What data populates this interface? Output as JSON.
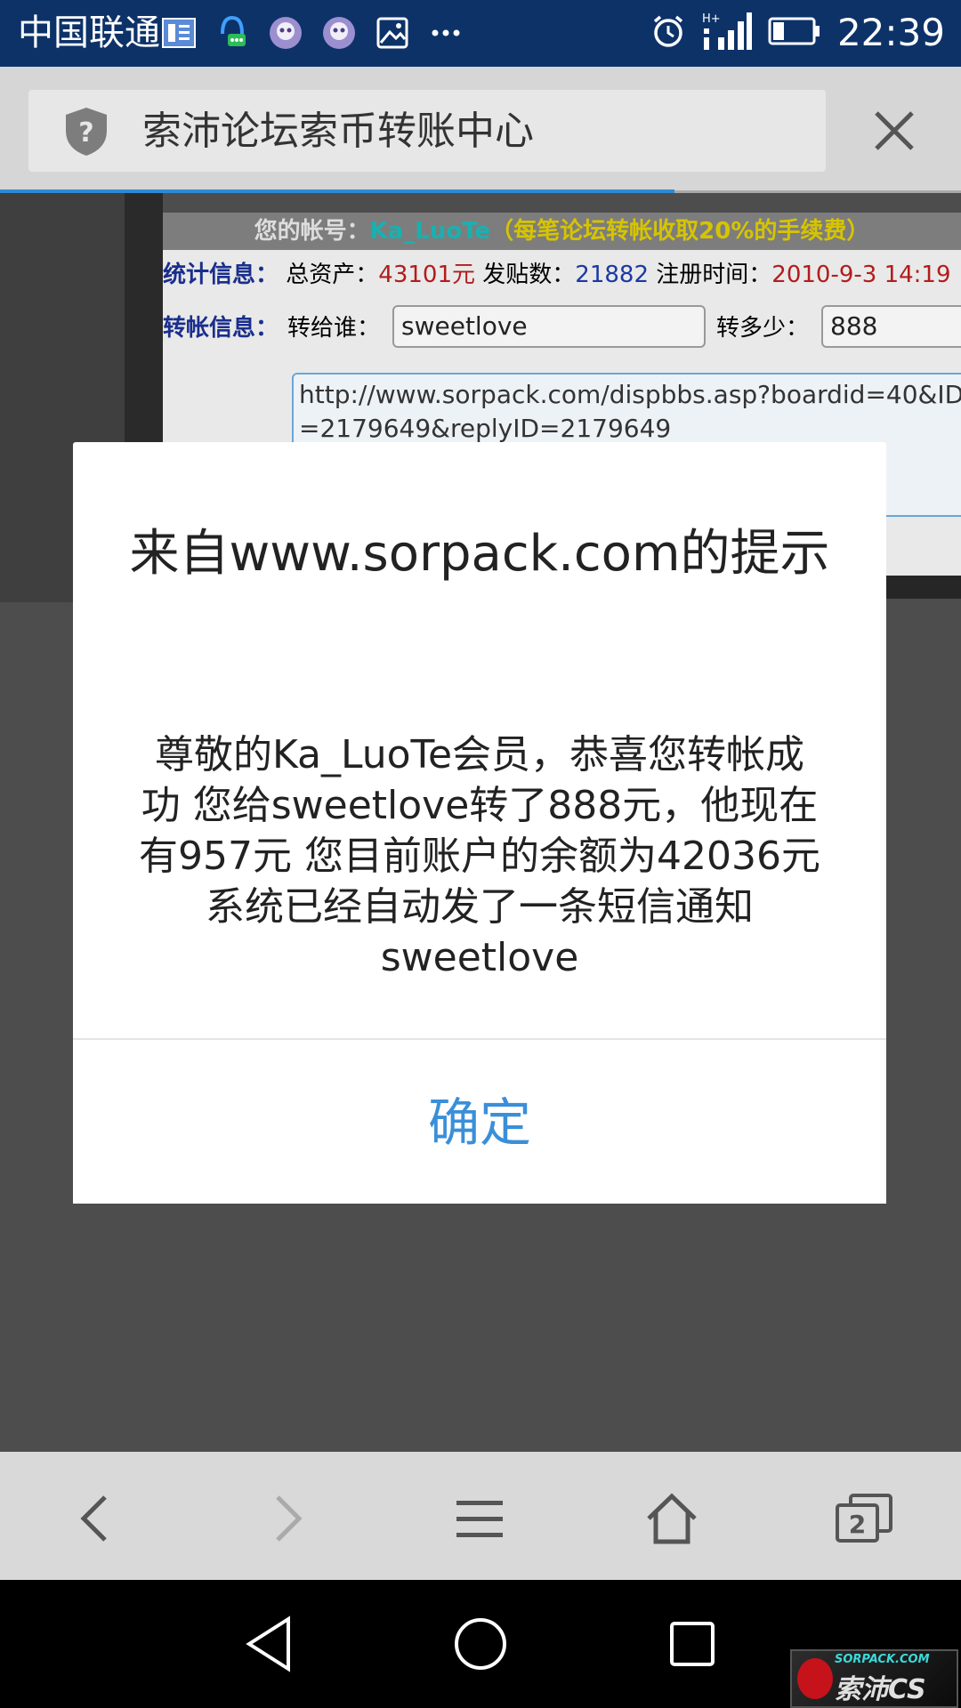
{
  "statusbar": {
    "carrier": "中国联通",
    "time": "22:39",
    "network": "H+"
  },
  "browser": {
    "page_title": "索沛论坛索币转账中心",
    "tabs_count": "2"
  },
  "form": {
    "account_label": "您的帐号：",
    "account_name": "Ka_LuoTe",
    "fee_note": "（每笔论坛转帐收取20%的手续费）",
    "stats_label": "统计信息：",
    "total_assets_label": "总资产：",
    "total_assets_value": "43101元",
    "posts_label": "发贴数：",
    "posts_value": "21882",
    "register_label": "注册时间：",
    "register_value": "2010-9-3 14:19",
    "transfer_label": "转帐信息：",
    "to_label": "转给谁：",
    "to_value": "sweetlove",
    "amount_label": "转多少：",
    "amount_value": "888",
    "reason_url": "http://www.sorpack.com/dispbbs.asp?boardid=40&ID=2179649&replyID=2179649"
  },
  "dialog": {
    "title": "来自www.sorpack.com的提示",
    "message": "尊敬的Ka_LuoTe会员，恭喜您转帐成功  您给sweetlove转了888元，他现在有957元  您目前账户的余额为42036元  系统已经自动发了一条短信通知sweetlove",
    "ok_label": "确定"
  },
  "watermark": {
    "site": "SORPACK.COM",
    "brand": "索沛CS"
  },
  "colors": {
    "statusbar_bg": "#0d3268",
    "accent_blue": "#3a8fd8",
    "progress": "#2d8bd6"
  }
}
